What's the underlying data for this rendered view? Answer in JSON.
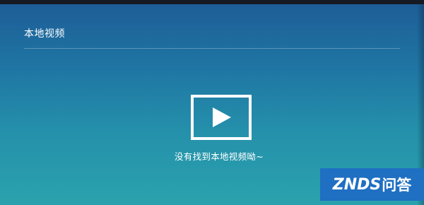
{
  "header": {
    "title": "本地视频"
  },
  "empty_state": {
    "icon": "play-video-icon",
    "message": "没有找到本地视频呦~"
  },
  "watermark": {
    "latin": "ZNDS",
    "cjk": "问答"
  },
  "colors": {
    "background_top": "#1d5c96",
    "background_bottom": "#2aa2ad",
    "text": "#ffffff",
    "watermark_bg": "#1f6fc2"
  }
}
